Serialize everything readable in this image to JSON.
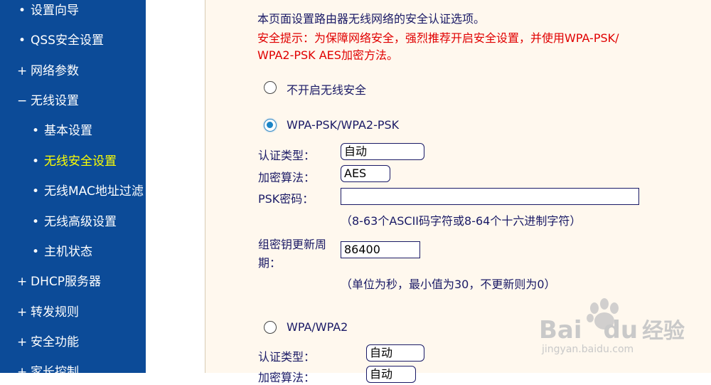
{
  "sidebar": {
    "items": [
      {
        "bullet": "•",
        "label": "设置向导"
      },
      {
        "bullet": "•",
        "label": "QSS安全设置"
      },
      {
        "bullet": "+",
        "label": "网络参数"
      },
      {
        "bullet": "−",
        "label": "无线设置"
      },
      {
        "bullet": "•",
        "label": "基本设置"
      },
      {
        "bullet": "•",
        "label": "无线安全设置",
        "active": true
      },
      {
        "bullet": "•",
        "label": "无线MAC地址过滤"
      },
      {
        "bullet": "•",
        "label": "无线高级设置"
      },
      {
        "bullet": "•",
        "label": "主机状态"
      },
      {
        "bullet": "+",
        "label": "DHCP服务器"
      },
      {
        "bullet": "+",
        "label": "转发规则"
      },
      {
        "bullet": "+",
        "label": "安全功能"
      },
      {
        "bullet": "+",
        "label": "家长控制"
      }
    ]
  },
  "main": {
    "intro": "本页面设置路由器无线网络的安全认证选项。",
    "warning_line1": "安全提示：为保障网络安全，强烈推荐开启安全设置，并使用WPA-PSK/",
    "warning_line2": "WPA2-PSK AES加密方法。",
    "option_none": "不开启无线安全",
    "option_wpa_psk": "WPA-PSK/WPA2-PSK",
    "auth_type_label": "认证类型：",
    "auth_type_value": "自动",
    "encrypt_label": "加密算法：",
    "encrypt_value": "AES",
    "psk_label": "PSK密码：",
    "psk_value": "",
    "psk_hint": "（8-63个ASCII码字符或8-64个十六进制字符）",
    "group_key_label_1": "组密钥更新周",
    "group_key_label_2": "期：",
    "group_key_value": "86400",
    "group_key_hint": "（单位为秒，最小值为30，不更新则为0）",
    "option_wpa": "WPA/WPA2",
    "auth_type_label_2": "认证类型：",
    "auth_type_value_2": "自动",
    "encrypt_label_2": "加密算法：",
    "encrypt_value_2": "自动"
  },
  "watermark": {
    "brand": "Bai",
    "brand2": "du",
    "text": "经验",
    "url": "jingyan.baidu.com"
  }
}
